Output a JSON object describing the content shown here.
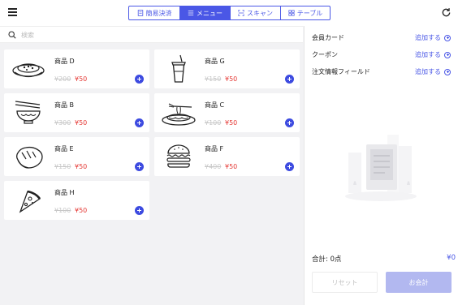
{
  "topbar": {
    "tabs": [
      {
        "label": "簡易決済",
        "icon": "receipt-icon",
        "active": false
      },
      {
        "label": "メニュー",
        "icon": "list-icon",
        "active": true
      },
      {
        "label": "スキャン",
        "icon": "scan-icon",
        "active": false
      },
      {
        "label": "テーブル",
        "icon": "grid-icon",
        "active": false
      }
    ]
  },
  "search": {
    "placeholder": "検索"
  },
  "products": [
    {
      "name": "商品 D",
      "old_price": "¥200",
      "price": "¥50",
      "icon": "curry-rice-icon"
    },
    {
      "name": "商品 G",
      "old_price": "¥150",
      "price": "¥50",
      "icon": "drink-cup-icon"
    },
    {
      "name": "商品 B",
      "old_price": "¥300",
      "price": "¥50",
      "icon": "noodle-bowl-icon"
    },
    {
      "name": "商品 C",
      "old_price": "¥100",
      "price": "¥50",
      "icon": "spaghetti-icon"
    },
    {
      "name": "商品 E",
      "old_price": "¥150",
      "price": "¥50",
      "icon": "bread-icon"
    },
    {
      "name": "商品 F",
      "old_price": "¥400",
      "price": "¥50",
      "icon": "burger-icon"
    },
    {
      "name": "商品 H",
      "old_price": "¥100",
      "price": "¥50",
      "icon": "pizza-icon"
    }
  ],
  "panel": {
    "rows": [
      {
        "label": "会員カード",
        "action": "追加する"
      },
      {
        "label": "クーポン",
        "action": "追加する"
      },
      {
        "label": "注文情報フィールド",
        "action": "追加する"
      }
    ],
    "total_label": "合計: 0点",
    "total_value": "¥0",
    "reset_label": "リセット",
    "checkout_label": "お会計"
  },
  "colors": {
    "accent": "#4a57e6",
    "price": "#e53935",
    "checkout_disabled": "#b2b8f0"
  }
}
